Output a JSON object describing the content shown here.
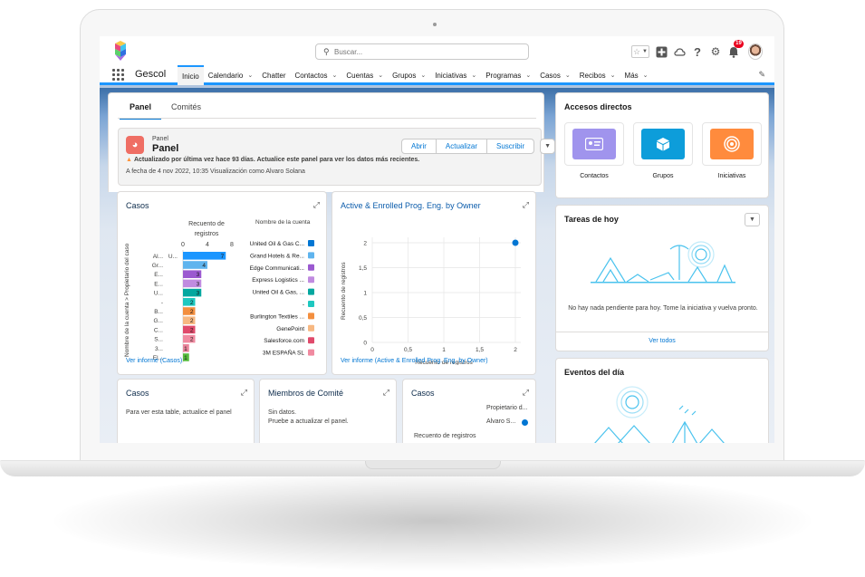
{
  "search": {
    "placeholder": "Buscar..."
  },
  "header": {
    "notification_count": "19"
  },
  "nav": {
    "app_name": "Gescol",
    "tabs": [
      {
        "label": "Inicio",
        "has_menu": false
      },
      {
        "label": "Calendario",
        "has_menu": true
      },
      {
        "label": "Chatter",
        "has_menu": false
      },
      {
        "label": "Contactos",
        "has_menu": true
      },
      {
        "label": "Cuentas",
        "has_menu": true
      },
      {
        "label": "Grupos",
        "has_menu": true
      },
      {
        "label": "Iniciativas",
        "has_menu": true
      },
      {
        "label": "Programas",
        "has_menu": true
      },
      {
        "label": "Casos",
        "has_menu": true
      },
      {
        "label": "Recibos",
        "has_menu": true
      },
      {
        "label": "Más",
        "has_menu": true
      }
    ]
  },
  "dashboard": {
    "tabs": [
      "Panel",
      "Comités"
    ],
    "subtitle": "Panel",
    "title": "Panel",
    "warning": "Actualizado por última vez hace 93 días. Actualice este panel para ver los datos más recientes.",
    "date_line": "A fecha de 4 nov 2022, 10:35 Visualización como Alvaro Solana",
    "buttons": {
      "open": "Abrir",
      "refresh": "Actualizar",
      "subscribe": "Suscribir"
    }
  },
  "casos_widget": {
    "title": "Casos",
    "link": "Ver informe (Casos)",
    "chart_data": {
      "type": "bar",
      "orientation": "horizontal",
      "title": "",
      "xlabel": "Recuento de registros",
      "ylabel": "Nombre de la cuenta > Propietario del caso",
      "legend_title": "Nombre de la cuenta",
      "xticks": [
        "0",
        "4",
        "8"
      ],
      "xlim": [
        0,
        8
      ],
      "categories": [
        "Al...",
        "Gr...",
        "E...",
        "E...",
        "U...",
        "-",
        "B...",
        "G...",
        "C...",
        "S...",
        "3...",
        "El..."
      ],
      "subcategories": [
        "U...",
        "",
        "",
        "",
        "",
        "",
        "",
        "",
        "",
        "",
        "",
        ""
      ],
      "values": [
        7,
        4,
        3,
        3,
        3,
        2,
        2,
        2,
        2,
        2,
        1,
        1
      ],
      "colors": [
        "#1b96ff",
        "#5fb4ee",
        "#9b59d0",
        "#c08be0",
        "#04a79f",
        "#1ec8c0",
        "#f38f3f",
        "#f7b882",
        "#e04a6b",
        "#f08aa0",
        "#e9849a",
        "#57bb3d"
      ],
      "legend": [
        {
          "name": "United Oil & Gas C...",
          "color": "#0176d3"
        },
        {
          "name": "Grand Hotels & Re...",
          "color": "#5fb4ee"
        },
        {
          "name": "Edge Communicati...",
          "color": "#9b59d0"
        },
        {
          "name": "Express Logistics ...",
          "color": "#c08be0"
        },
        {
          "name": "United Oil & Gas, ...",
          "color": "#04a79f"
        },
        {
          "name": "-",
          "color": "#1ec8c0"
        },
        {
          "name": "Burlington Textiles ...",
          "color": "#f38f3f"
        },
        {
          "name": "GenePoint",
          "color": "#f7b882"
        },
        {
          "name": "Salesforce.com",
          "color": "#e04a6b"
        },
        {
          "name": "3M ESPAÑA SL",
          "color": "#f08aa0"
        }
      ]
    }
  },
  "active_widget": {
    "title": "Active & Enrolled Prog. Eng. by Owner",
    "link": "Ver informe (Active & Enrolled Prog. Eng. by Owner)",
    "chart_data": {
      "type": "scatter",
      "title": "",
      "xlabel": "Recuento de registros",
      "ylabel": "Recuento de registros",
      "xlim": [
        0,
        2
      ],
      "ylim": [
        0,
        2
      ],
      "xticks": [
        "0",
        "0,5",
        "1",
        "1,5",
        "2"
      ],
      "yticks": [
        "0",
        "0,5",
        "1",
        "1,5",
        "2"
      ],
      "points": [
        {
          "x": 2,
          "y": 2
        }
      ],
      "color": "#0176d3"
    }
  },
  "casos2_widget": {
    "title": "Casos",
    "message": "Para ver esta table, actualice el panel"
  },
  "miembros_widget": {
    "title": "Miembros de Comité",
    "line1": "Sin datos.",
    "line2": "Pruebe a actualizar el panel."
  },
  "casos3_widget": {
    "title": "Casos",
    "legend_title": "Propietario d...",
    "legend_item": "Alvaro S...",
    "axis_label": "Recuento de registros"
  },
  "accesos": {
    "title": "Accesos directos",
    "items": [
      {
        "label": "Contactos",
        "color": "#a094ed"
      },
      {
        "label": "Grupos",
        "color": "#0d9dda"
      },
      {
        "label": "Iniciativas",
        "color": "#ff8b3d"
      }
    ]
  },
  "tareas": {
    "title": "Tareas de hoy",
    "message": "No hay nada pendiente para hoy. Tome la iniciativa y vuelva pronto.",
    "link": "Ver todos"
  },
  "eventos": {
    "title": "Eventos del día"
  }
}
